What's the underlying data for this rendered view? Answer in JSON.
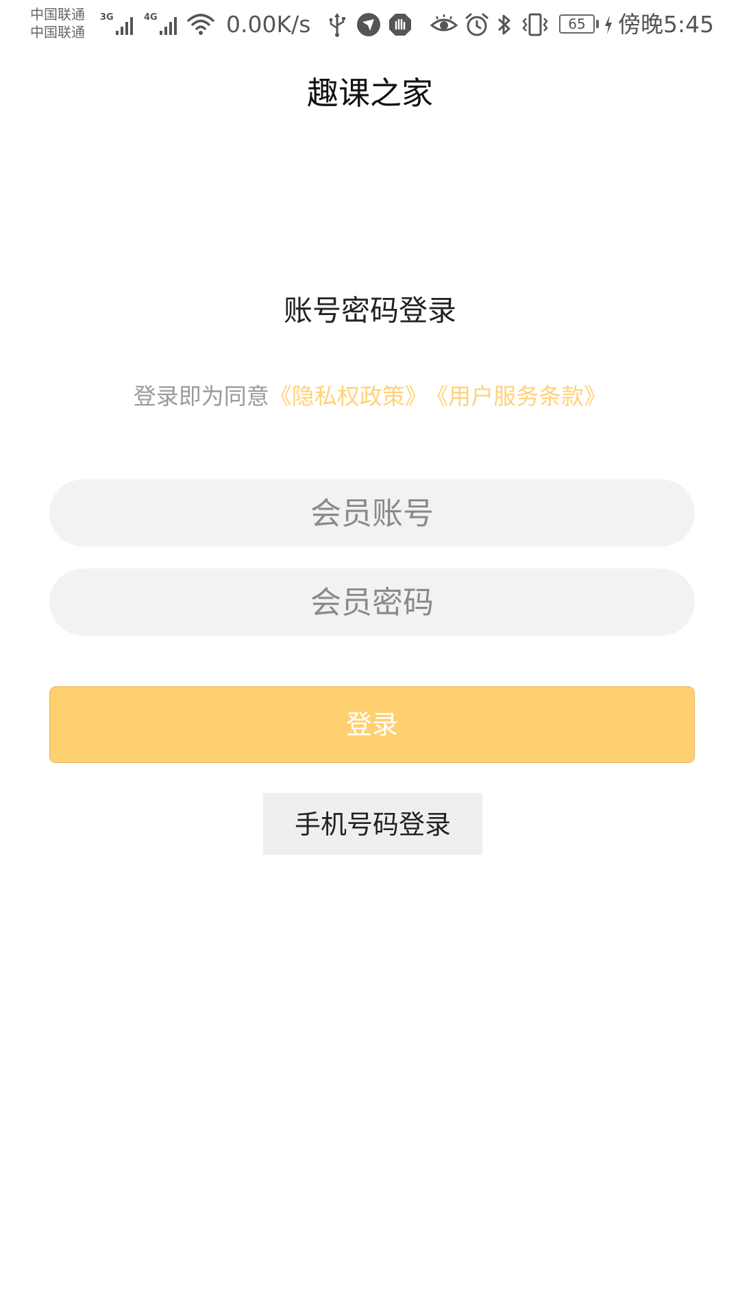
{
  "status_bar": {
    "carrier_1": "中国联通",
    "carrier_2": "中国联通",
    "network_1": "3G",
    "network_2": "4G",
    "net_speed": "0.00K/s",
    "battery_level": "65",
    "time": "傍晚5:45",
    "icons": [
      "signal-icon",
      "signal-icon",
      "wifi-icon",
      "usb-icon",
      "app-notification-icon",
      "app-notification-icon",
      "eye-comfort-icon",
      "alarm-icon",
      "bluetooth-icon",
      "vibrate-icon",
      "battery-icon",
      "charging-icon"
    ]
  },
  "header": {
    "title": "趣课之家"
  },
  "login": {
    "heading": "账号密码登录",
    "agreement_prefix": "登录即为同意",
    "privacy_link": "《隐私权政策》",
    "terms_link": "《用户服务条款》",
    "account_placeholder": "会员账号",
    "password_placeholder": "会员密码",
    "login_button": "登录",
    "phone_login_button": "手机号码登录"
  },
  "colors": {
    "accent": "#ffd070",
    "link": "#ffd27a",
    "input_bg": "#f2f2f2",
    "secondary_button_bg": "#efefef"
  }
}
